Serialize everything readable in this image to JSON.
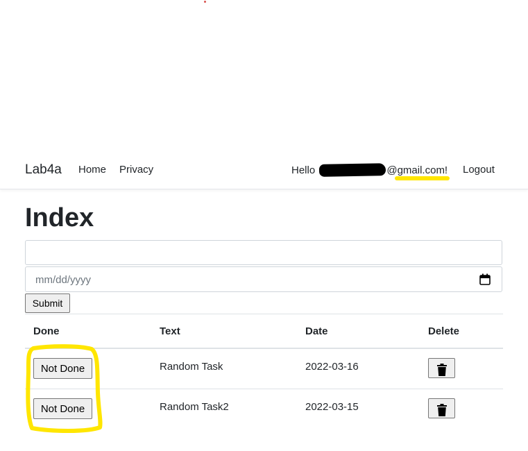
{
  "navbar": {
    "brand": "Lab4a",
    "links": [
      "Home",
      "Privacy"
    ],
    "greeting_prefix": "Hello ",
    "greeting_email_suffix": "@gmail.com!",
    "logout": "Logout"
  },
  "page": {
    "title": "Index"
  },
  "form": {
    "text_value": "",
    "date_placeholder": "mm/dd/yyyy",
    "submit_label": "Submit"
  },
  "table": {
    "headers": [
      "Done",
      "Text",
      "Date",
      "Delete"
    ],
    "rows": [
      {
        "done_label": "Not Done",
        "text": "Random Task",
        "date": "2022-03-16"
      },
      {
        "done_label": "Not Done",
        "text": "Random Task2",
        "date": "2022-03-15"
      }
    ]
  },
  "colors": {
    "highlight": "#ffe600",
    "text": "#212529",
    "border": "#dee2e6"
  },
  "icons": {
    "calendar": "calendar-icon",
    "trash": "trash-icon"
  }
}
